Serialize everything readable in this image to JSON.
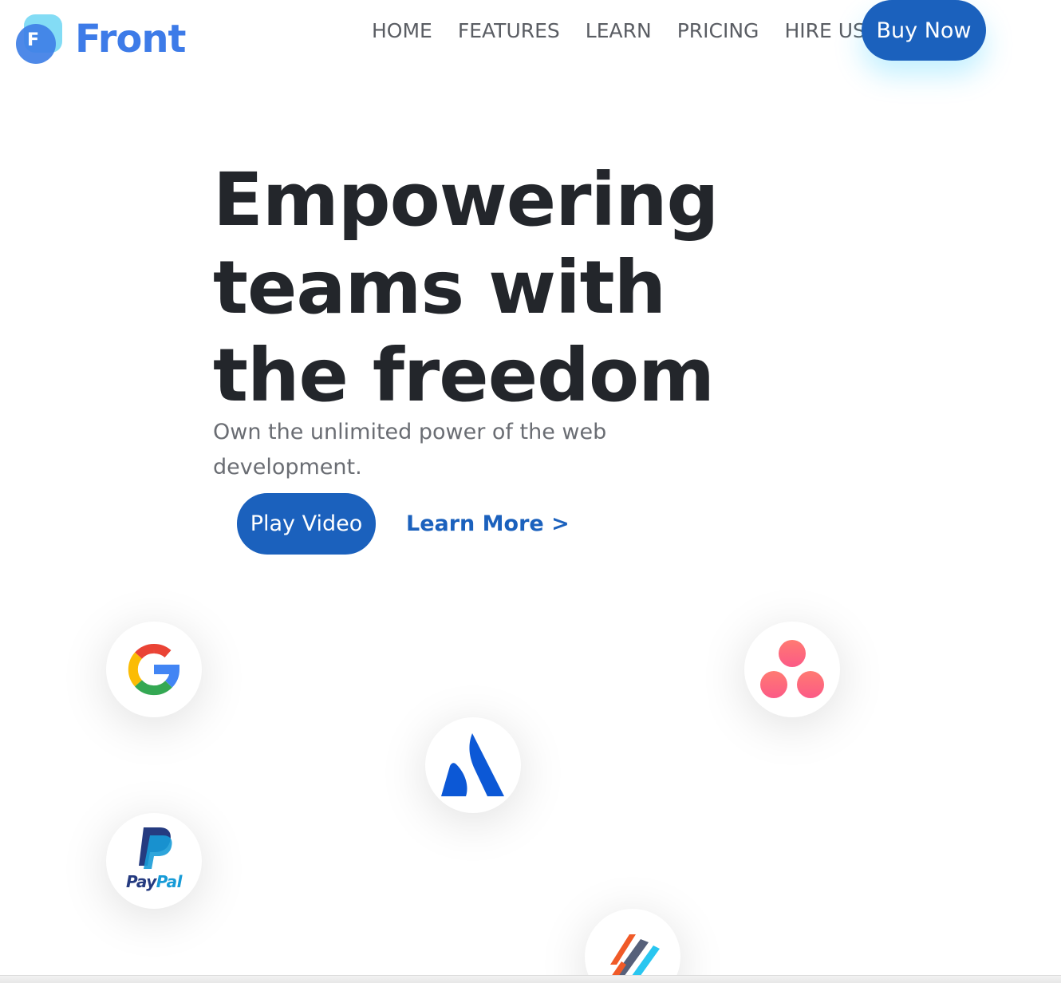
{
  "brand": {
    "logo_letter": "F",
    "name": "Front",
    "color": "#3d7be8"
  },
  "nav": {
    "items": [
      {
        "label": "HOME"
      },
      {
        "label": "FEATURES"
      },
      {
        "label": "LEARN"
      },
      {
        "label": "PRICING"
      },
      {
        "label": "HIRE US"
      }
    ],
    "cta_label": "Buy Now"
  },
  "hero": {
    "title": "Empowering teams with the freedom",
    "subtitle": "Own the unlimited power of the web development.",
    "primary_button_label": "Play Video",
    "secondary_link_label": "Learn More >"
  },
  "partner_logos": [
    {
      "name": "google-logo",
      "icon": "google-icon"
    },
    {
      "name": "asana-logo",
      "icon": "asana-icon"
    },
    {
      "name": "atlassian-logo",
      "icon": "atlassian-icon"
    },
    {
      "name": "paypal-logo",
      "icon": "paypal-icon",
      "word_pay": "Pay",
      "word_pal": "Pal"
    },
    {
      "name": "treehouse-logo",
      "icon": "stripes-icon"
    }
  ],
  "colors": {
    "accent": "#1b61bd",
    "heading": "#23262b",
    "body_text": "#6a6d73",
    "nav_text": "#5a5d63"
  }
}
